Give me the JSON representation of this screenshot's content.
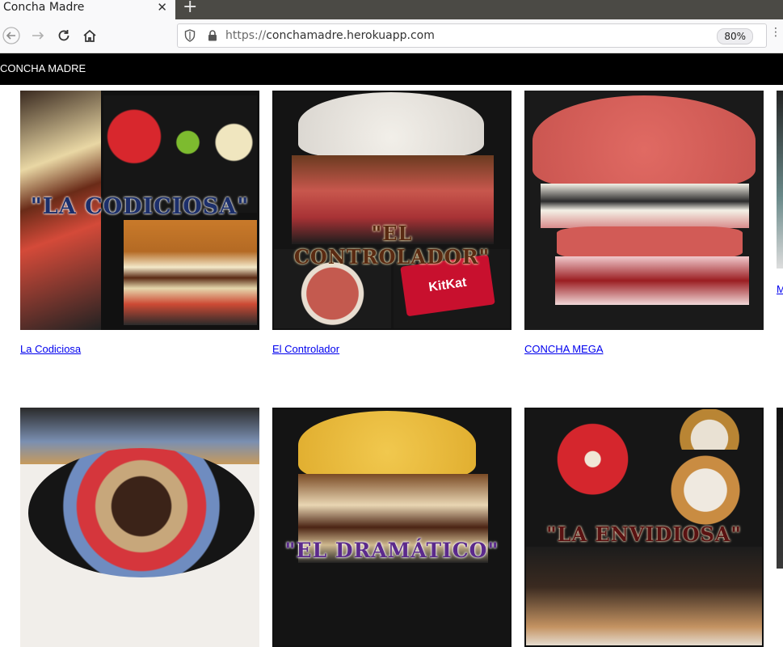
{
  "browser": {
    "tab_title": "Concha Madre",
    "url_protocol": "https://",
    "url_host": "conchamadre.herokuapp.com",
    "zoom": "80%"
  },
  "site": {
    "brand": "CONCHA MADRE",
    "products": [
      {
        "name": "La Codiciosa",
        "image_text": "\"LA CODICIOSA\""
      },
      {
        "name": "El Controlador",
        "image_text": "\"EL CONTROLADOR\"",
        "badge": "KitKat"
      },
      {
        "name": "CONCHA MEGA"
      },
      {
        "name": "M"
      },
      {
        "image_text": ""
      },
      {
        "image_text": "\"EL DRAMÁTICO\""
      },
      {
        "image_text": "\"LA ENVIDIOSA\""
      }
    ]
  }
}
